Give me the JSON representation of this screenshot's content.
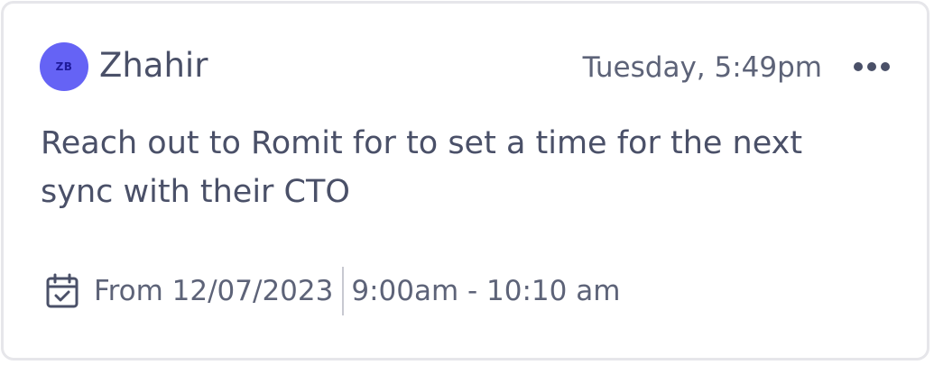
{
  "note": {
    "author": {
      "initials": "ZB",
      "name": "Zhahir",
      "avatar_color": "#6563F5"
    },
    "timestamp": "Tuesday, 5:49pm",
    "more_icon": "more-horizontal-icon",
    "message": "Reach out to Romit for to set a time for the next sync with their CTO",
    "schedule": {
      "icon": "calendar-check-icon",
      "from_label": "From 12/07/2023",
      "time_range": "9:00am - 10:10 am"
    }
  },
  "colors": {
    "text": "#4A5068",
    "muted_text": "#5D6378",
    "border": "#E6E6EA",
    "divider": "#C8C9D1"
  }
}
